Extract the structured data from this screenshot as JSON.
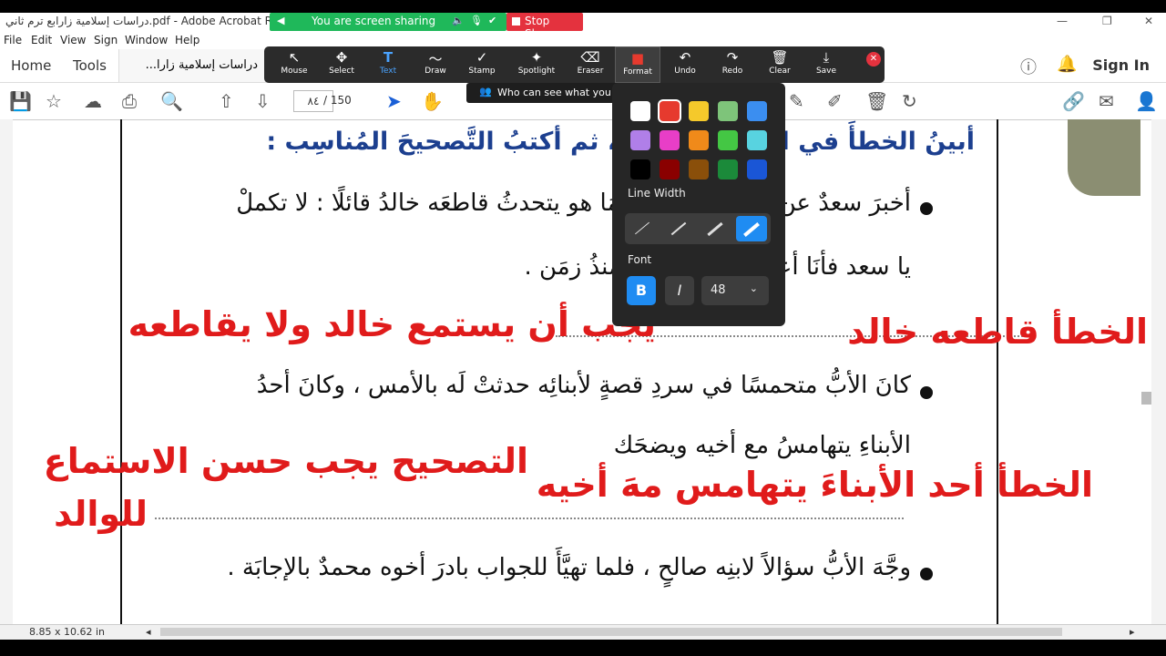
{
  "titlebar": {
    "title": "دراسات إسلامية زارابع ترم ثاني.pdf - Adobe Acrobat Reade",
    "min": "—",
    "max": "❐",
    "close": "✕"
  },
  "share": {
    "status": "You are screen sharing",
    "stop": "Stop Share",
    "tooltip": "Who can see what you share here?"
  },
  "menu": [
    "File",
    "Edit",
    "View",
    "Sign",
    "Window",
    "Help"
  ],
  "tabs": {
    "home": "Home",
    "tools": "Tools",
    "doc": "دراسات إسلامية زارا...",
    "doc_close": "✕",
    "signin": "Sign In"
  },
  "page_nav": {
    "current": "٨٤",
    "total": "/ 150"
  },
  "annotate_tools": [
    {
      "label": "Mouse",
      "icon": "↖"
    },
    {
      "label": "Select",
      "icon": "✥"
    },
    {
      "label": "Text",
      "icon": "T"
    },
    {
      "label": "Draw",
      "icon": "〜"
    },
    {
      "label": "Stamp",
      "icon": "✓"
    },
    {
      "label": "Spotlight",
      "icon": "✦"
    },
    {
      "label": "Eraser",
      "icon": "⌫"
    },
    {
      "label": "Format",
      "icon": "■"
    },
    {
      "label": "Undo",
      "icon": "↶"
    },
    {
      "label": "Redo",
      "icon": "↷"
    },
    {
      "label": "Clear",
      "icon": "🗑"
    },
    {
      "label": "Save",
      "icon": "⤓"
    }
  ],
  "format_panel": {
    "line_width_title": "Line Width",
    "font_title": "Font",
    "bold": "B",
    "italic": "I",
    "font_size": "48",
    "colors": [
      "#ffffff",
      "#e63a2e",
      "#f5c92b",
      "#7ec47a",
      "#3b8ef0",
      "#b07fe8",
      "#e83ec7",
      "#f08a1a",
      "#44c744",
      "#58d3e0",
      "#000000",
      "#8a0000",
      "#8a4f0a",
      "#1b8a3a",
      "#1a56d6"
    ],
    "selected_color": "#e63a2e"
  },
  "document": {
    "heading": "أبينُ الخطأَ في المواقفِ الآتيةِ، ثم أكتبُ التَّصحيحَ المُناسِب :",
    "item1_line1": "أخبرَ سعدٌ عن قصةٍ قرأها، وبينمَا هو يتحدثُ قاطعَه خالدُ قائلًا : لا تكملْ",
    "item1_line2": "يا سعد فأنَا أعرفُ هذه القصةَ منذُ زمَن .",
    "item2_line1": "كانَ الأبُّ متحمسًا في سردِ قصةٍ لأبنائِه حدثتْ لَه بالأمس ، وكانَ أحدُ",
    "item2_line2": "الأبناءِ يتهامسُ مع أخيه ويضحَك",
    "item3_line1": "وجَّهَ الأبُّ سؤالاً لابنِه صالحٍ ، فلما تهيَّأَ للجواب بادرَ أخوه محمدٌ بالإجابَة ."
  },
  "annotations": {
    "a1": "يجب أن يستمع خالد ولا يقاطعه",
    "a2": "الخطأ   قاطعه خالد",
    "a3_line1": "التصحيح يجب حسن الاستماع",
    "a3_line2": "للوالد",
    "a4": "الخطأ أحد الأبناءَ يتهامس مهَ أخيه",
    "ink_color": "#e01b1b"
  },
  "status": {
    "page_size": "8.85 x 10.62 in"
  }
}
